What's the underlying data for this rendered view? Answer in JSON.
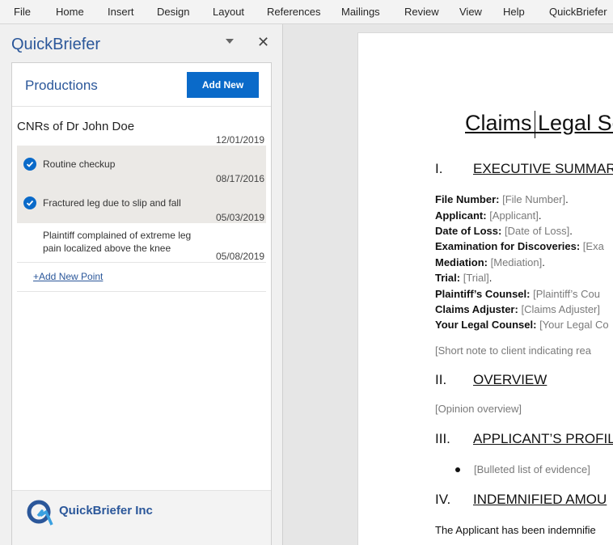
{
  "ribbon": {
    "tabs": [
      "File",
      "Home",
      "Insert",
      "Design",
      "Layout",
      "References",
      "Mailings",
      "Review",
      "View",
      "Help",
      "QuickBriefer"
    ]
  },
  "pane": {
    "title": "QuickBriefer",
    "close_glyph": "✕",
    "section_title": "Productions",
    "add_new_label": "Add New",
    "group": {
      "title": "CNRs of Dr John Doe",
      "date": "12/01/2019"
    },
    "items": [
      {
        "text": "Routine checkup",
        "date": "08/17/2016",
        "checked": true
      },
      {
        "text": "Fractured leg due to slip and fall",
        "date": "05/03/2019",
        "checked": true
      },
      {
        "text": "Plaintiff complained of extreme leg pain localized above the knee",
        "date": "05/08/2019",
        "checked": false
      }
    ],
    "add_point_label": "+Add New Point",
    "footer_brand": "QuickBriefer Inc"
  },
  "document": {
    "title": "Claims Legal Se",
    "sections": [
      {
        "num": "I.",
        "title": "EXECUTIVE SUMMAR"
      },
      {
        "num": "II.",
        "title": "OVERVIEW"
      },
      {
        "num": "III.",
        "title": "APPLICANT’S PROFIL"
      },
      {
        "num": "IV.",
        "title": "INDEMNIFIED AMOU"
      }
    ],
    "fields": [
      {
        "label": "File Number:",
        "value": "[File Number]",
        "suffix": "."
      },
      {
        "label": "Applicant:",
        "value": "[Applicant]",
        "suffix": "."
      },
      {
        "label": "Date of Loss:",
        "value": "[Date of Loss]",
        "suffix": "."
      },
      {
        "label": "Examination for Discoveries:",
        "value": "[Exa",
        "suffix": ""
      },
      {
        "label": "Mediation:",
        "value": "[Mediation]",
        "suffix": "."
      },
      {
        "label": "Trial:",
        "value": "[Trial]",
        "suffix": "."
      },
      {
        "label": "Plaintiff’s Counsel:",
        "value": "[Plaintiff’s Cou",
        "suffix": ""
      },
      {
        "label": "Claims Adjuster:",
        "value": "[Claims Adjuster]",
        "suffix": ""
      },
      {
        "label": "Your Legal Counsel:",
        "value": "[Your Legal Co",
        "suffix": ""
      }
    ],
    "short_note": "[Short note to client indicating rea",
    "opinion": "[Opinion overview]",
    "bullet": "[Bulleted list of evidence]",
    "paragraph": "The Applicant has been indemnifie"
  },
  "colors": {
    "accent": "#2b579a",
    "button": "#0a6ac9",
    "selected_row": "#ebe9e6"
  }
}
